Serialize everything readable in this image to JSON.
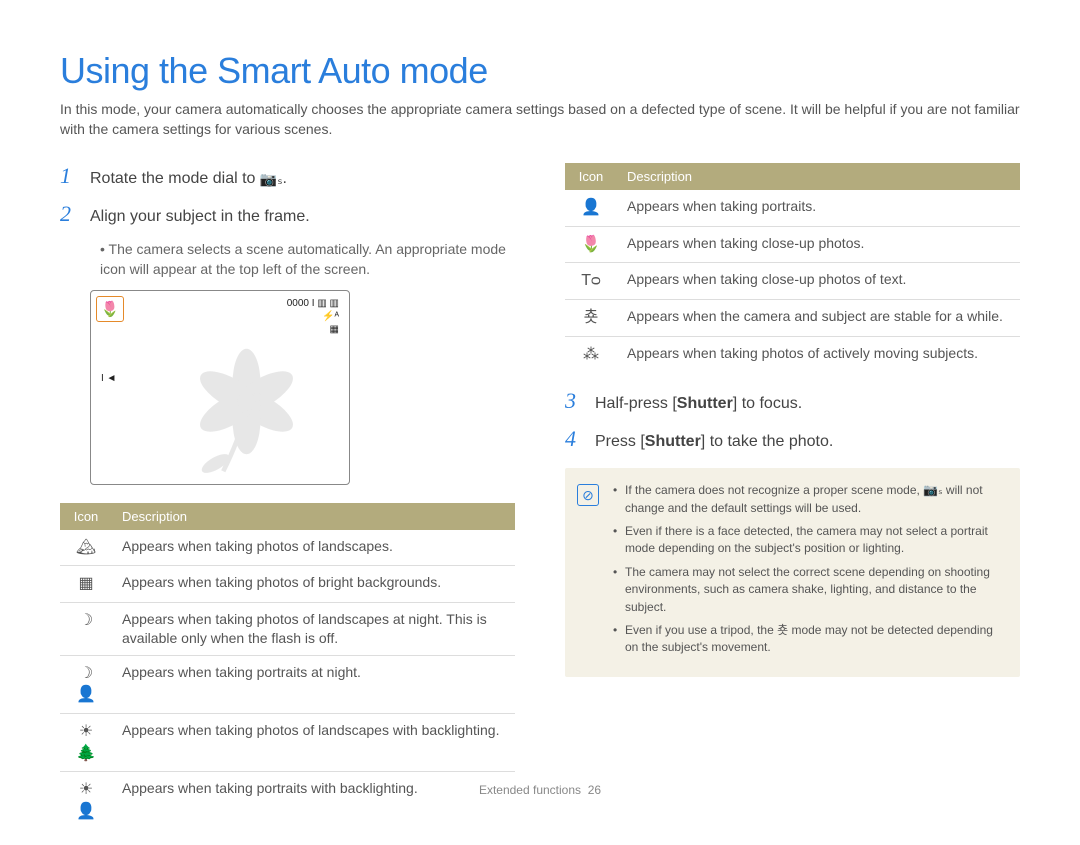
{
  "title": "Using the Smart Auto mode",
  "intro": "In this mode, your camera automatically chooses the appropriate camera settings based on a defected type of scene. It will be helpful if you are not familiar with the camera settings for various scenes.",
  "step1": {
    "num": "1",
    "text_pre": "Rotate the mode dial to ",
    "inline_icon": "📷ₛ",
    "text_post": "."
  },
  "step2": {
    "num": "2",
    "text": "Align your subject in the frame.",
    "bullet": "The camera selects a scene automatically. An appropriate mode icon will appear at the top left of the screen."
  },
  "screen": {
    "corner_icon": "🌷",
    "counter": "0000 I",
    "play_marker": "I ◄"
  },
  "table_left_headers": {
    "icon": "Icon",
    "desc": "Description"
  },
  "table_left_rows": [
    {
      "icon": "🏔",
      "desc": "Appears when taking photos of landscapes."
    },
    {
      "icon": "▦",
      "desc": "Appears when taking photos of bright backgrounds."
    },
    {
      "icon": "☽",
      "desc": "Appears when taking photos of landscapes at night. This is available only when the flash is off."
    },
    {
      "icon": "☽👤",
      "desc": "Appears when taking portraits at night."
    },
    {
      "icon": "☀🌲",
      "desc": "Appears when taking photos of landscapes with backlighting."
    },
    {
      "icon": "☀👤",
      "desc": "Appears when taking portraits with backlighting."
    }
  ],
  "table_right_headers": {
    "icon": "Icon",
    "desc": "Description"
  },
  "table_right_rows": [
    {
      "icon": "👤",
      "desc": "Appears when taking portraits."
    },
    {
      "icon": "🌷",
      "desc": "Appears when taking close-up photos."
    },
    {
      "icon": "Tᴑ",
      "desc": "Appears when taking close-up photos of text."
    },
    {
      "icon": "춋",
      "desc": "Appears when the camera and subject are stable for a while."
    },
    {
      "icon": "⁂",
      "desc": "Appears when taking photos of actively moving subjects."
    }
  ],
  "step3": {
    "num": "3",
    "text_pre": "Half-press [",
    "strong": "Shutter",
    "text_post": "] to focus."
  },
  "step4": {
    "num": "4",
    "text_pre": "Press [",
    "strong": "Shutter",
    "text_post": "] to take the photo."
  },
  "note_icon": "⊘",
  "notes": [
    "If the camera does not recognize a proper scene mode, 📷ₛ will not change and the default settings will be used.",
    "Even if there is a face detected, the camera may not select a portrait mode depending on the subject's position or lighting.",
    "The camera may not select the correct scene depending on shooting environments, such as camera shake, lighting, and distance to the subject.",
    "Even if you use a tripod, the 춋 mode may not be detected depending on the subject's movement."
  ],
  "footer": {
    "section": "Extended functions",
    "page": "26"
  }
}
